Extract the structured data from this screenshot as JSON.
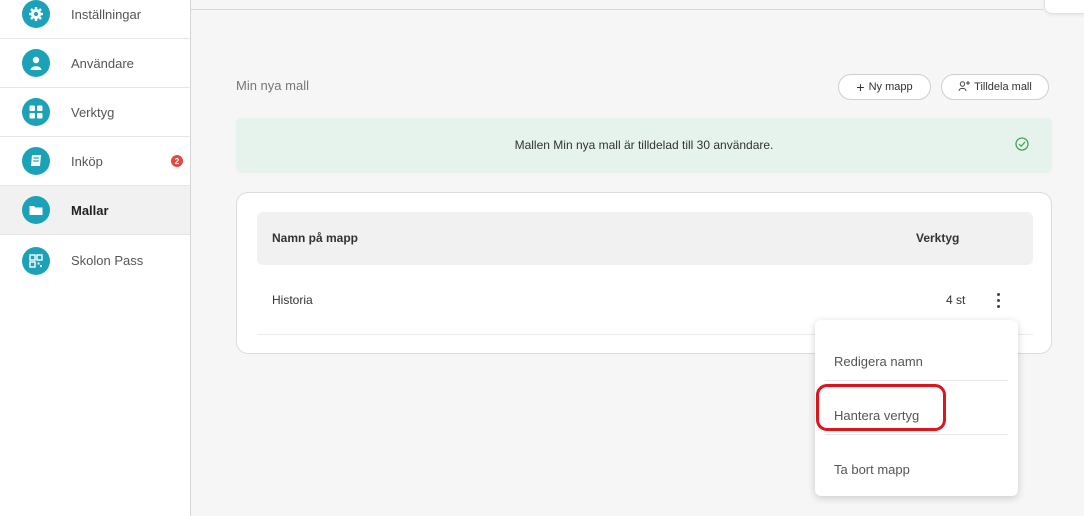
{
  "sidebar": {
    "items": [
      {
        "label": "Inställningar",
        "icon": "gear-icon"
      },
      {
        "label": "Användare",
        "icon": "user-icon"
      },
      {
        "label": "Verktyg",
        "icon": "grid-icon"
      },
      {
        "label": "Inköp",
        "icon": "book-icon",
        "badge": "2"
      },
      {
        "label": "Mallar",
        "icon": "folder-icon",
        "active": true
      },
      {
        "label": "Skolon Pass",
        "icon": "qr-code-icon"
      }
    ]
  },
  "header": {
    "title": "Min nya mall",
    "new_folder_label": "Ny mapp",
    "assign_label": "Tilldela mall"
  },
  "alert": {
    "message": "Mallen Min nya mall är tilldelad till 30 användare."
  },
  "table": {
    "columns": [
      "Namn på mapp",
      "Verktyg"
    ],
    "rows": [
      {
        "name": "Historia",
        "count": "4 st"
      }
    ]
  },
  "menu": {
    "items": [
      "Redigera namn",
      "Hantera vertyg",
      "Ta bort mapp"
    ]
  },
  "colors": {
    "accent": "#1ba2b8",
    "badge": "#e24b3f",
    "alert_bg": "#e6f3ec",
    "success": "#3fa65a",
    "highlight": "#e0141b"
  }
}
